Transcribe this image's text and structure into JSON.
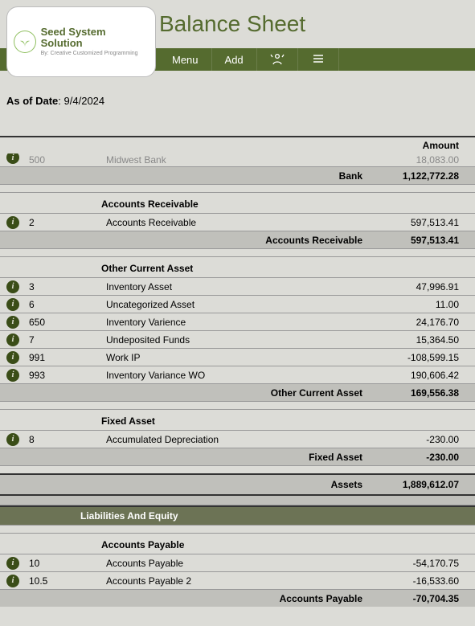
{
  "title": "Balance Sheet",
  "brand": {
    "main": "Seed System Solution",
    "sub": "By: Creative Customized Programming"
  },
  "nav": {
    "menu": "Menu",
    "add": "Add"
  },
  "asof": {
    "label": "As of Date",
    "value": "9/4/2024"
  },
  "amount_header": "Amount",
  "partial_bank_row": {
    "code": "500",
    "desc": "Midwest Bank",
    "amount": "18,083.00"
  },
  "bank_subtotal": {
    "label": "Bank",
    "amount": "1,122,772.28"
  },
  "sections": {
    "ar": {
      "header": "Accounts Receivable",
      "rows": [
        {
          "code": "2",
          "desc": "Accounts Receivable",
          "amount": "597,513.41"
        }
      ],
      "subtotal": {
        "label": "Accounts Receivable",
        "amount": "597,513.41"
      }
    },
    "oca": {
      "header": "Other Current Asset",
      "rows": [
        {
          "code": "3",
          "desc": "Inventory Asset",
          "amount": "47,996.91"
        },
        {
          "code": "6",
          "desc": "Uncategorized Asset",
          "amount": "11.00"
        },
        {
          "code": "650",
          "desc": "Inventory Varience",
          "amount": "24,176.70"
        },
        {
          "code": "7",
          "desc": "Undeposited Funds",
          "amount": "15,364.50"
        },
        {
          "code": "991",
          "desc": "Work IP",
          "amount": "-108,599.15"
        },
        {
          "code": "993",
          "desc": "Inventory Variance WO",
          "amount": "190,606.42"
        }
      ],
      "subtotal": {
        "label": "Other Current Asset",
        "amount": "169,556.38"
      }
    },
    "fa": {
      "header": "Fixed Asset",
      "rows": [
        {
          "code": "8",
          "desc": "Accumulated Depreciation",
          "amount": "-230.00"
        }
      ],
      "subtotal": {
        "label": "Fixed Asset",
        "amount": "-230.00"
      }
    }
  },
  "assets_total": {
    "label": "Assets",
    "amount": "1,889,612.07"
  },
  "liab_header": "Liabilities And Equity",
  "ap": {
    "header": "Accounts Payable",
    "rows": [
      {
        "code": "10",
        "desc": "Accounts Payable",
        "amount": "-54,170.75"
      },
      {
        "code": "10.5",
        "desc": "Accounts Payable 2",
        "amount": "-16,533.60"
      }
    ],
    "subtotal": {
      "label": "Accounts Payable",
      "amount": "-70,704.35"
    }
  }
}
